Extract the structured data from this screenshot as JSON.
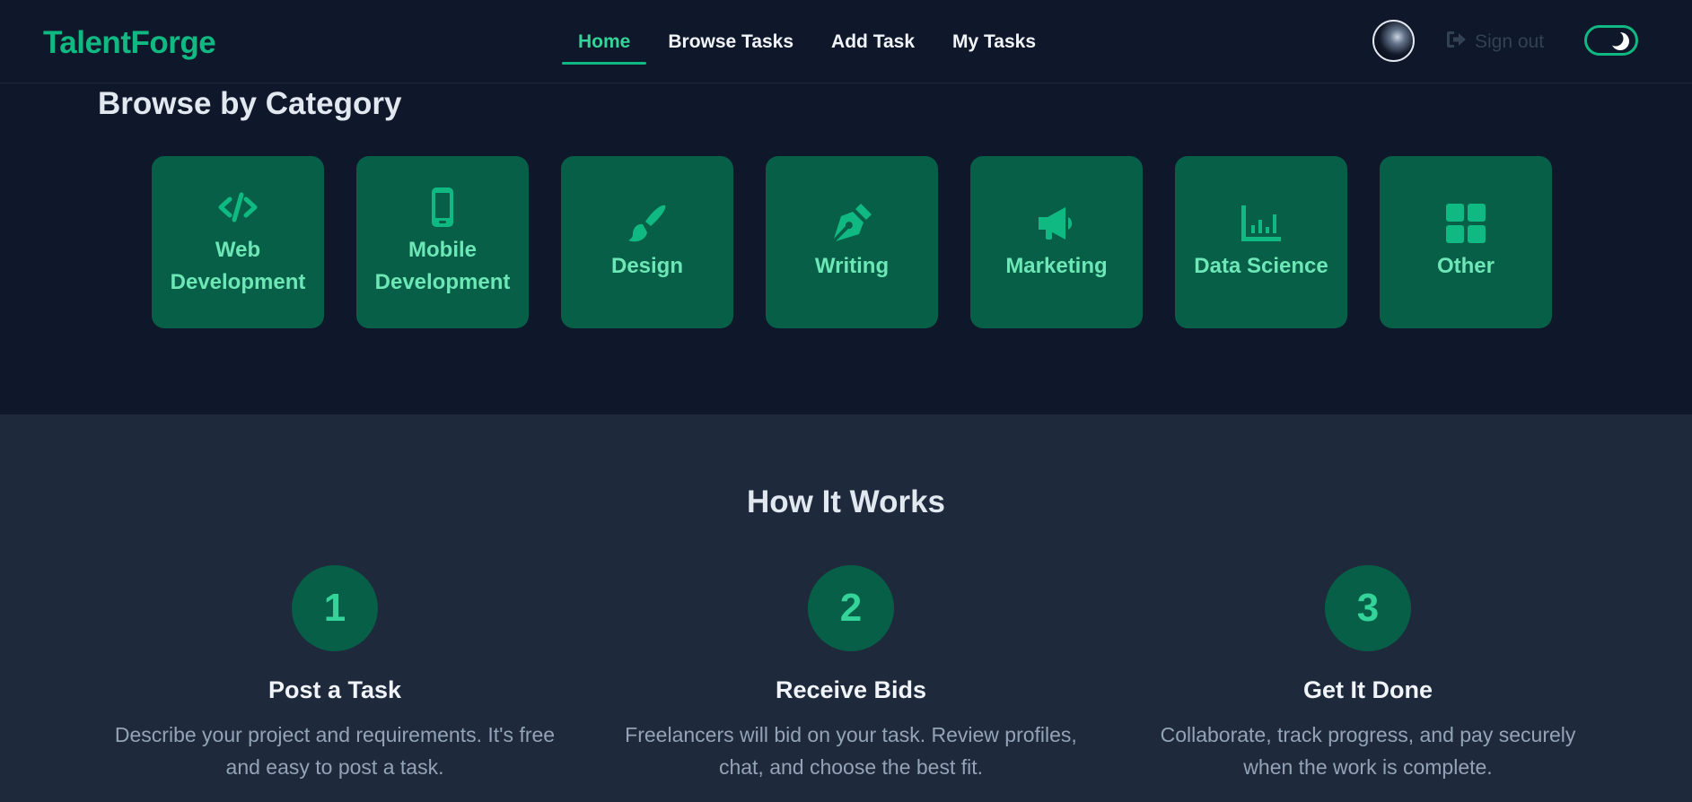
{
  "header": {
    "logo": "TalentForge",
    "nav": [
      {
        "label": "Home",
        "active": true
      },
      {
        "label": "Browse Tasks",
        "active": false
      },
      {
        "label": "Add Task",
        "active": false
      },
      {
        "label": "My Tasks",
        "active": false
      }
    ],
    "signout_label": "Sign out",
    "theme_toggle_icon": "moon-icon"
  },
  "browse": {
    "title": "Browse by Category",
    "categories": [
      {
        "label": "Web Development",
        "icon": "code-icon"
      },
      {
        "label": "Mobile Development",
        "icon": "mobile-phone-icon"
      },
      {
        "label": "Design",
        "icon": "paintbrush-icon"
      },
      {
        "label": "Writing",
        "icon": "pen-nib-icon"
      },
      {
        "label": "Marketing",
        "icon": "megaphone-icon"
      },
      {
        "label": "Data Science",
        "icon": "bar-chart-icon"
      },
      {
        "label": "Other",
        "icon": "grid-icon"
      }
    ]
  },
  "how": {
    "title": "How It Works",
    "steps": [
      {
        "num": "1",
        "title": "Post a Task",
        "desc": "Describe your project and requirements. It's free and easy to post a task."
      },
      {
        "num": "2",
        "title": "Receive Bids",
        "desc": "Freelancers will bid on your task. Review profiles, chat, and choose the best fit."
      },
      {
        "num": "3",
        "title": "Get It Done",
        "desc": "Collaborate, track progress, and pay securely when the work is complete."
      }
    ]
  },
  "colors": {
    "accent": "#10b981",
    "accent_light": "#6ee7b7",
    "card_bg": "#065f46",
    "page_bg": "#0f172a",
    "section_bg": "#1e293b"
  }
}
